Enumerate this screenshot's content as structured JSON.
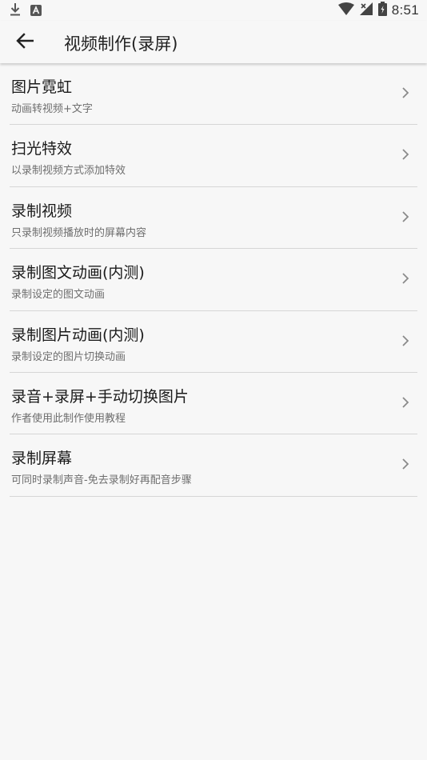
{
  "status_bar": {
    "time": "8:51",
    "left_icons": [
      "download-icon",
      "notification-a-icon"
    ],
    "right_icons": [
      "wifi-icon",
      "signal-icon",
      "battery-icon"
    ]
  },
  "app_bar": {
    "title": "视频制作(录屏)",
    "back_icon": "arrow-left-icon"
  },
  "menu": {
    "items": [
      {
        "title": "图片霓虹",
        "subtitle": "动画转视频+文字"
      },
      {
        "title": "扫光特效",
        "subtitle": "以录制视频方式添加特效"
      },
      {
        "title": "录制视频",
        "subtitle": "只录制视频播放时的屏幕内容"
      },
      {
        "title": "录制图文动画(内测)",
        "subtitle": "录制设定的图文动画"
      },
      {
        "title": "录制图片动画(内测)",
        "subtitle": "录制设定的图片切换动画"
      },
      {
        "title": "录音+录屏+手动切换图片",
        "subtitle": "作者使用此制作使用教程"
      },
      {
        "title": "录制屏幕",
        "subtitle": "可同时录制声音-免去录制好再配音步骤"
      }
    ]
  },
  "colors": {
    "background": "#f7f7f7",
    "title_text": "#1a1a1a",
    "subtitle_text": "#6e6e6e",
    "divider": "#d6d6d6"
  }
}
